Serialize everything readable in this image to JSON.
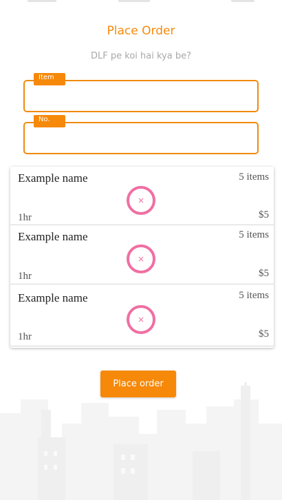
{
  "header": {
    "title": "Place Order",
    "subtitle": "DLF pe koi hai kya be?"
  },
  "form": {
    "item_label": "Item",
    "item_value": "",
    "no_label": "No.",
    "no_value": ""
  },
  "orders": [
    {
      "name": "Example name",
      "count": "5 items",
      "time": "1hr",
      "price": "$5",
      "remove_glyph": "×"
    },
    {
      "name": "Example name",
      "count": "5 items",
      "time": "1hr",
      "price": "$5",
      "remove_glyph": "×"
    },
    {
      "name": "Example name",
      "count": "5 items",
      "time": "1hr",
      "price": "$5",
      "remove_glyph": "×"
    }
  ],
  "actions": {
    "place_order_label": "Place order"
  },
  "colors": {
    "accent": "#f6890a",
    "remove": "#f06fa2",
    "subtitle": "#a8a8a8"
  },
  "icons": {
    "remove": "close-icon",
    "background": "city-skyline-illustration"
  }
}
